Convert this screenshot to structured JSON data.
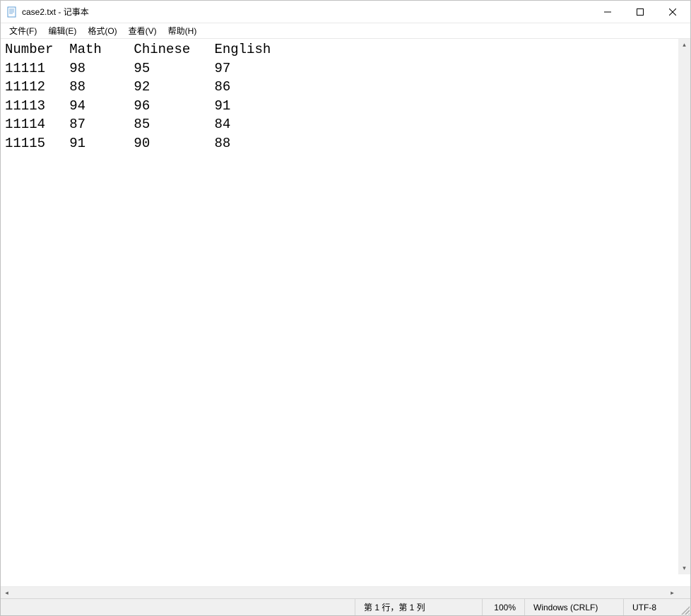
{
  "window": {
    "title": "case2.txt - 记事本"
  },
  "menu": {
    "file": "文件(F)",
    "edit": "编辑(E)",
    "format": "格式(O)",
    "view": "查看(V)",
    "help": "帮助(H)"
  },
  "content": {
    "headers": [
      "Number",
      "Math",
      "Chinese",
      "English"
    ],
    "rows": [
      [
        "11111",
        "98",
        "95",
        "97"
      ],
      [
        "11112",
        "88",
        "92",
        "86"
      ],
      [
        "11113",
        "94",
        "96",
        "91"
      ],
      [
        "11114",
        "87",
        "85",
        "84"
      ],
      [
        "11115",
        "91",
        "90",
        "88"
      ]
    ]
  },
  "status": {
    "position": "第 1 行，第 1 列",
    "zoom": "100%",
    "line_ending": "Windows (CRLF)",
    "encoding": "UTF-8"
  }
}
